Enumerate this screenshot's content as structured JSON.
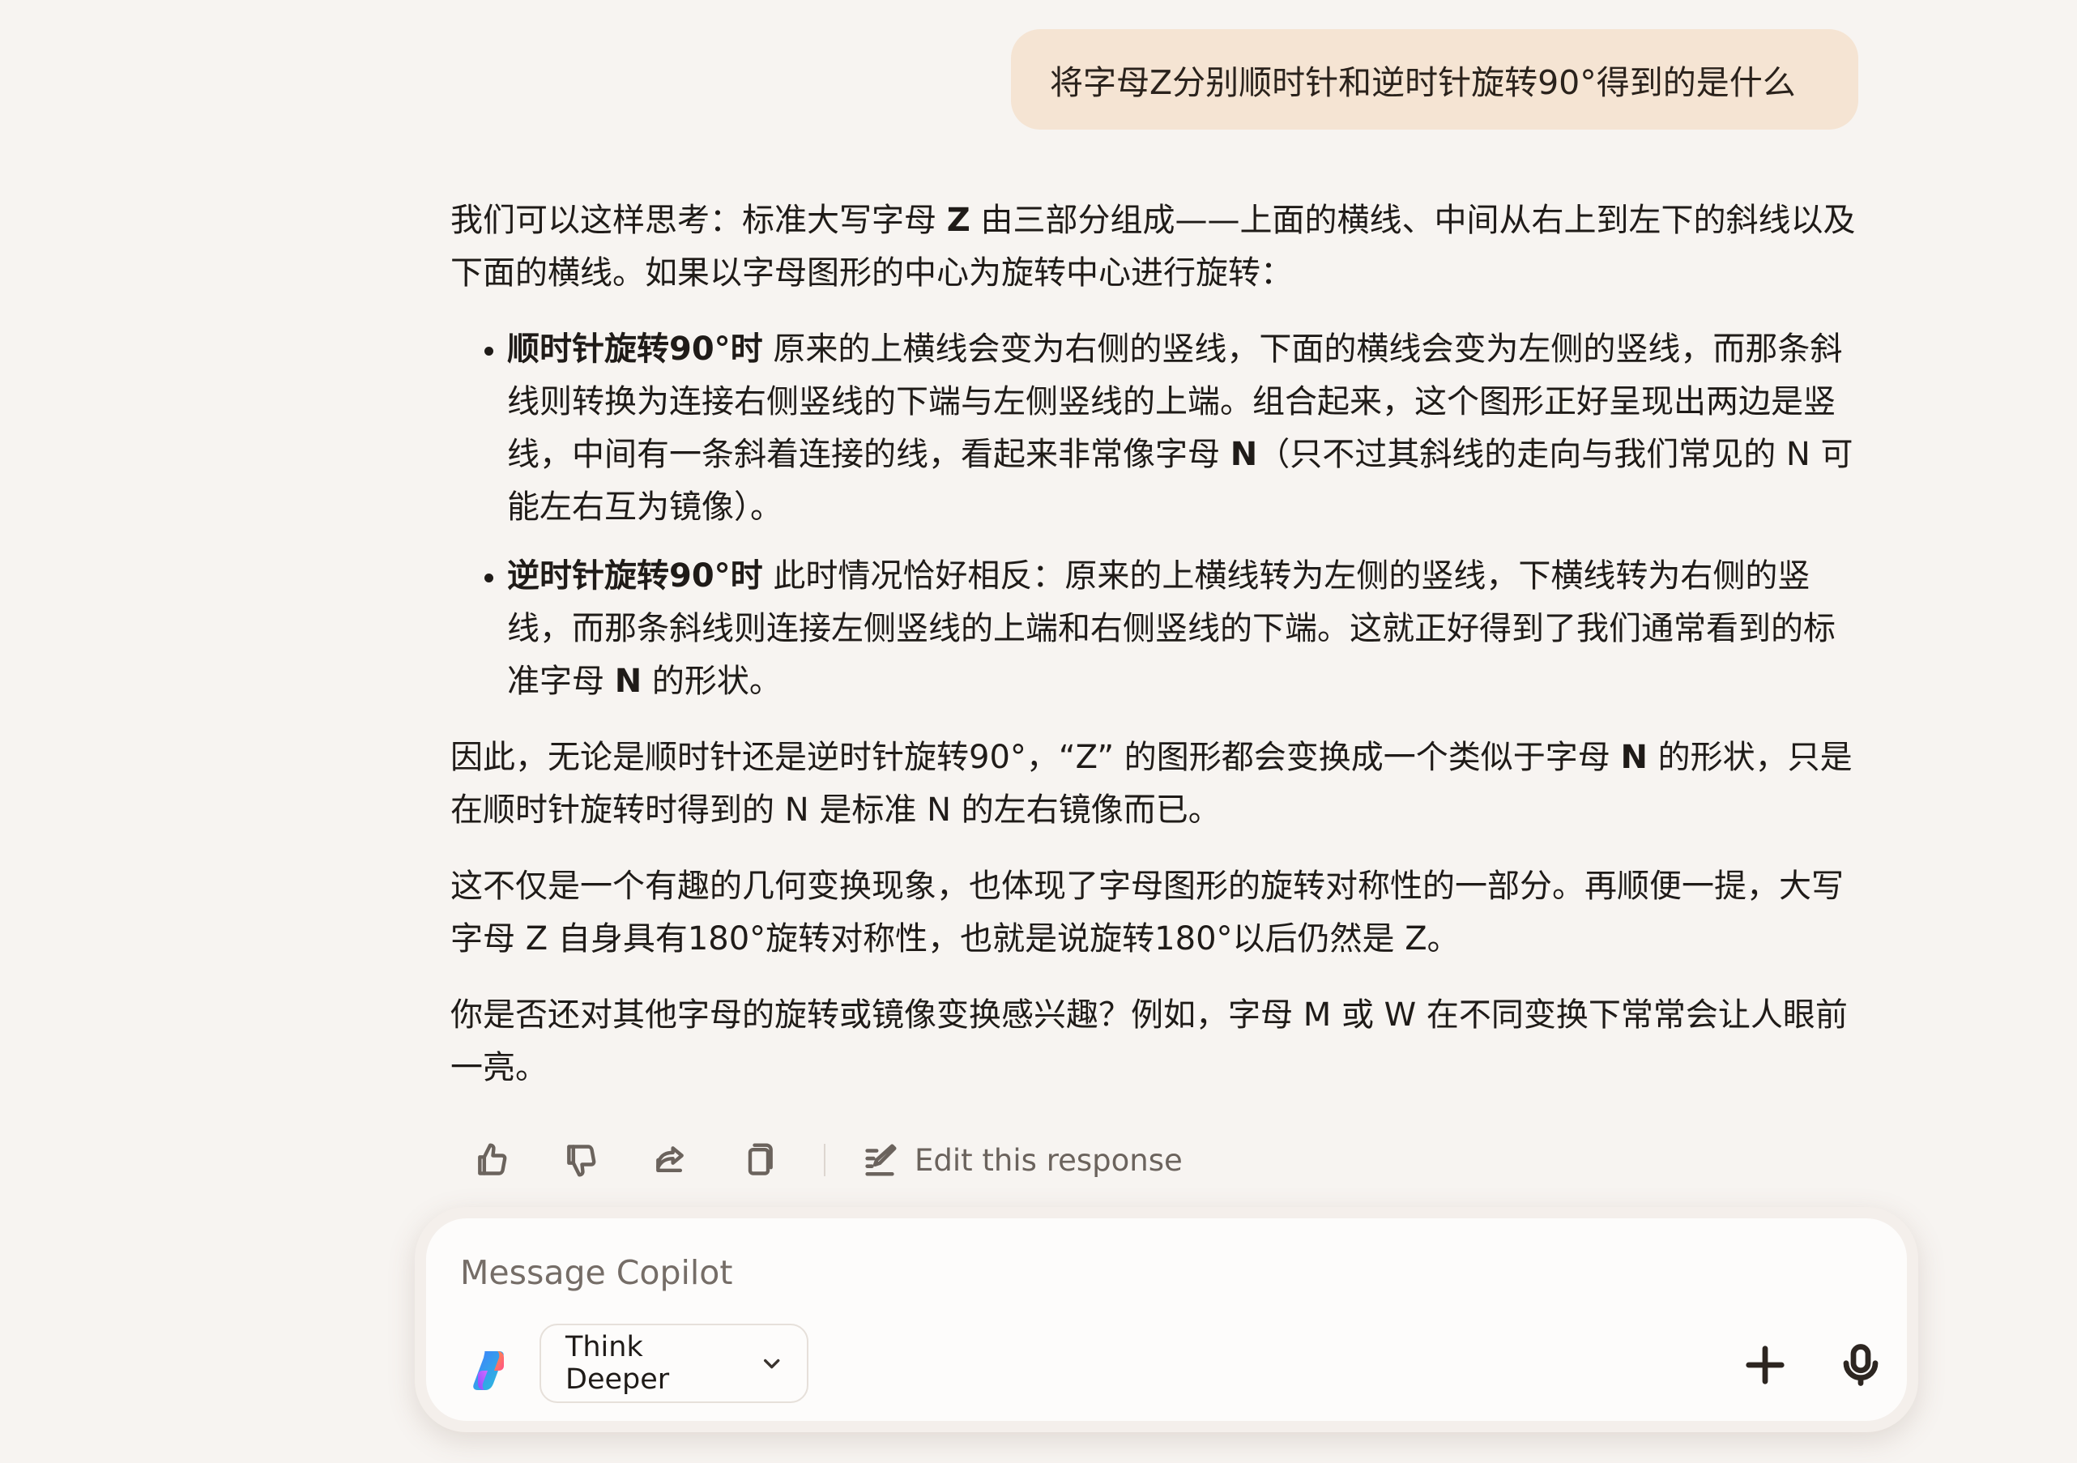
{
  "user_message": "将字母Z分别顺时针和逆时针旋转90°得到的是什么",
  "response": {
    "intro_a": "我们可以这样思考：标准大写字母 ",
    "intro_bold": "Z",
    "intro_b": " 由三部分组成——上面的横线、中间从右上到左下的斜线以及下面的横线。如果以字母图形的中心为旋转中心进行旋转：",
    "bullet1_bold": "顺时针旋转90°时",
    "bullet1_a": " 原来的上横线会变为右侧的竖线，下面的横线会变为左侧的竖线，而那条斜线则转换为连接右侧竖线的下端与左侧竖线的上端。组合起来，这个图形正好呈现出两边是竖线，中间有一条斜着连接的线，看起来非常像字母 ",
    "bullet1_bold2": "N",
    "bullet1_b": "（只不过其斜线的走向与我们常见的 N 可能左右互为镜像）。",
    "bullet2_bold": "逆时针旋转90°时",
    "bullet2_a": " 此时情况恰好相反：原来的上横线转为左侧的竖线，下横线转为右侧的竖线，而那条斜线则连接左侧竖线的上端和右侧竖线的下端。这就正好得到了我们通常看到的标准字母 ",
    "bullet2_bold2": "N",
    "bullet2_b": " 的形状。",
    "para2_a": "因此，无论是顺时针还是逆时针旋转90°，“Z” 的图形都会变换成一个类似于字母 ",
    "para2_bold": "N",
    "para2_b": " 的形状，只是在顺时针旋转时得到的 N 是标准 N 的左右镜像而已。",
    "para3": "这不仅是一个有趣的几何变换现象，也体现了字母图形的旋转对称性的一部分。再顺便一提，大写字母 Z 自身具有180°旋转对称性，也就是说旋转180°以后仍然是 Z。",
    "para4": "你是否还对其他字母的旋转或镜像变换感兴趣？例如，字母 M 或 W 在不同变换下常常会让人眼前一亮。"
  },
  "actions": {
    "edit_label": "Edit this response"
  },
  "composer": {
    "placeholder": "Message Copilot",
    "mode_label": "Think Deeper"
  }
}
